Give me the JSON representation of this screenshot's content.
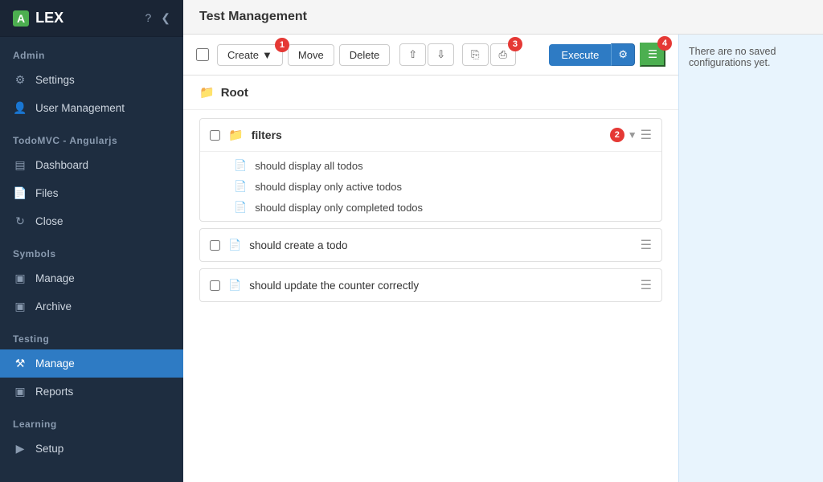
{
  "header": {
    "title": "Test Management"
  },
  "logo": {
    "letter": "A",
    "name": "LEX"
  },
  "toolbar": {
    "create_label": "Create",
    "move_label": "Move",
    "delete_label": "Delete",
    "execute_label": "Execute",
    "badge1": "1",
    "badge2": "2",
    "badge3": "3",
    "badge4": "4"
  },
  "root": {
    "label": "Root"
  },
  "sidebar_nav": {
    "admin_label": "Admin",
    "settings_label": "Settings",
    "user_management_label": "User Management",
    "todomvc_label": "TodoMVC - Angularjs",
    "dashboard_label": "Dashboard",
    "files_label": "Files",
    "close_label": "Close",
    "symbols_label": "Symbols",
    "manage_symbols_label": "Manage",
    "archive_label": "Archive",
    "testing_label": "Testing",
    "manage_testing_label": "Manage",
    "reports_label": "Reports",
    "learning_label": "Learning",
    "setup_label": "Setup"
  },
  "test_groups": [
    {
      "id": "filters",
      "type": "folder",
      "name": "filters",
      "children": [
        {
          "name": "should display all todos"
        },
        {
          "name": "should display only active todos"
        },
        {
          "name": "should display only completed todos"
        }
      ]
    }
  ],
  "test_items": [
    {
      "name": "should create a todo"
    },
    {
      "name": "should update the counter correctly"
    }
  ],
  "side_panel": {
    "message": "There are no saved configurations yet."
  }
}
